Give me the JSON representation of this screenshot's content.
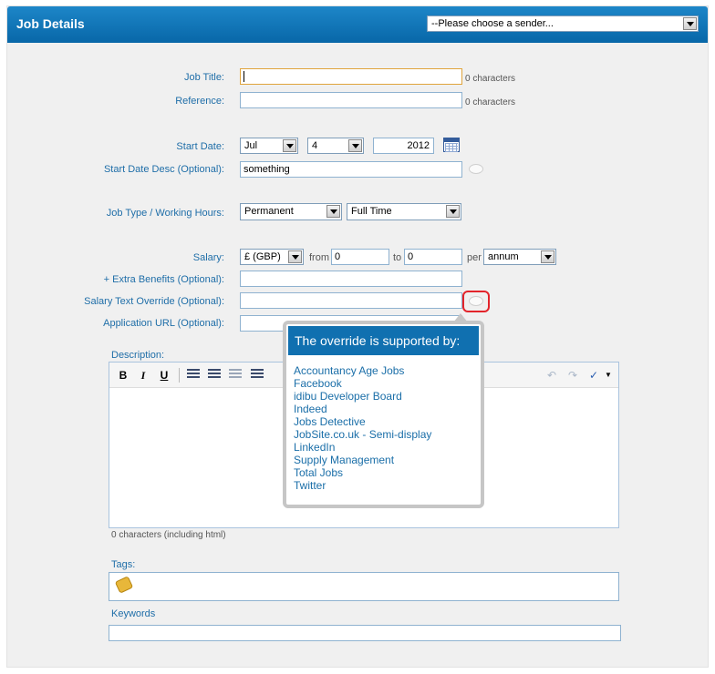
{
  "header": {
    "title": "Job Details",
    "sender_select": "--Please choose a sender..."
  },
  "fields": {
    "job_title": {
      "label": "Job Title:",
      "count": "0 characters"
    },
    "reference": {
      "label": "Reference:",
      "count": "0 characters"
    },
    "start_date": {
      "label": "Start Date:",
      "month": "Jul",
      "day": "4",
      "year": "2012"
    },
    "start_date_desc": {
      "label": "Start Date Desc (Optional):",
      "value": "something"
    },
    "job_type": {
      "label": "Job Type / Working Hours:",
      "type": "Permanent",
      "hours": "Full Time"
    },
    "salary": {
      "label": "Salary:",
      "currency": "£ (GBP)",
      "from_label": "from",
      "from_value": "0",
      "to_label": "to",
      "to_value": "0",
      "per_label": "per",
      "per_value": "annum"
    },
    "extra_benefits": {
      "label": "+ Extra Benefits (Optional):"
    },
    "salary_override": {
      "label": "Salary Text Override (Optional):"
    },
    "application_url": {
      "label": "Application URL (Optional):"
    },
    "description": {
      "label": "Description:",
      "count": "0 characters (including html)"
    },
    "tags": {
      "label": "Tags:"
    },
    "keywords": {
      "label": "Keywords"
    }
  },
  "editor_toolbar": {
    "bold": "B",
    "italic": "I",
    "underline": "U"
  },
  "popup": {
    "title": "The override is supported by:",
    "items": [
      "Accountancy Age Jobs",
      "Facebook",
      "idibu Developer Board",
      "Indeed",
      "Jobs Detective",
      "JobSite.co.uk - Semi-display",
      "LinkedIn",
      "Supply Management",
      "Total Jobs",
      "Twitter"
    ]
  }
}
